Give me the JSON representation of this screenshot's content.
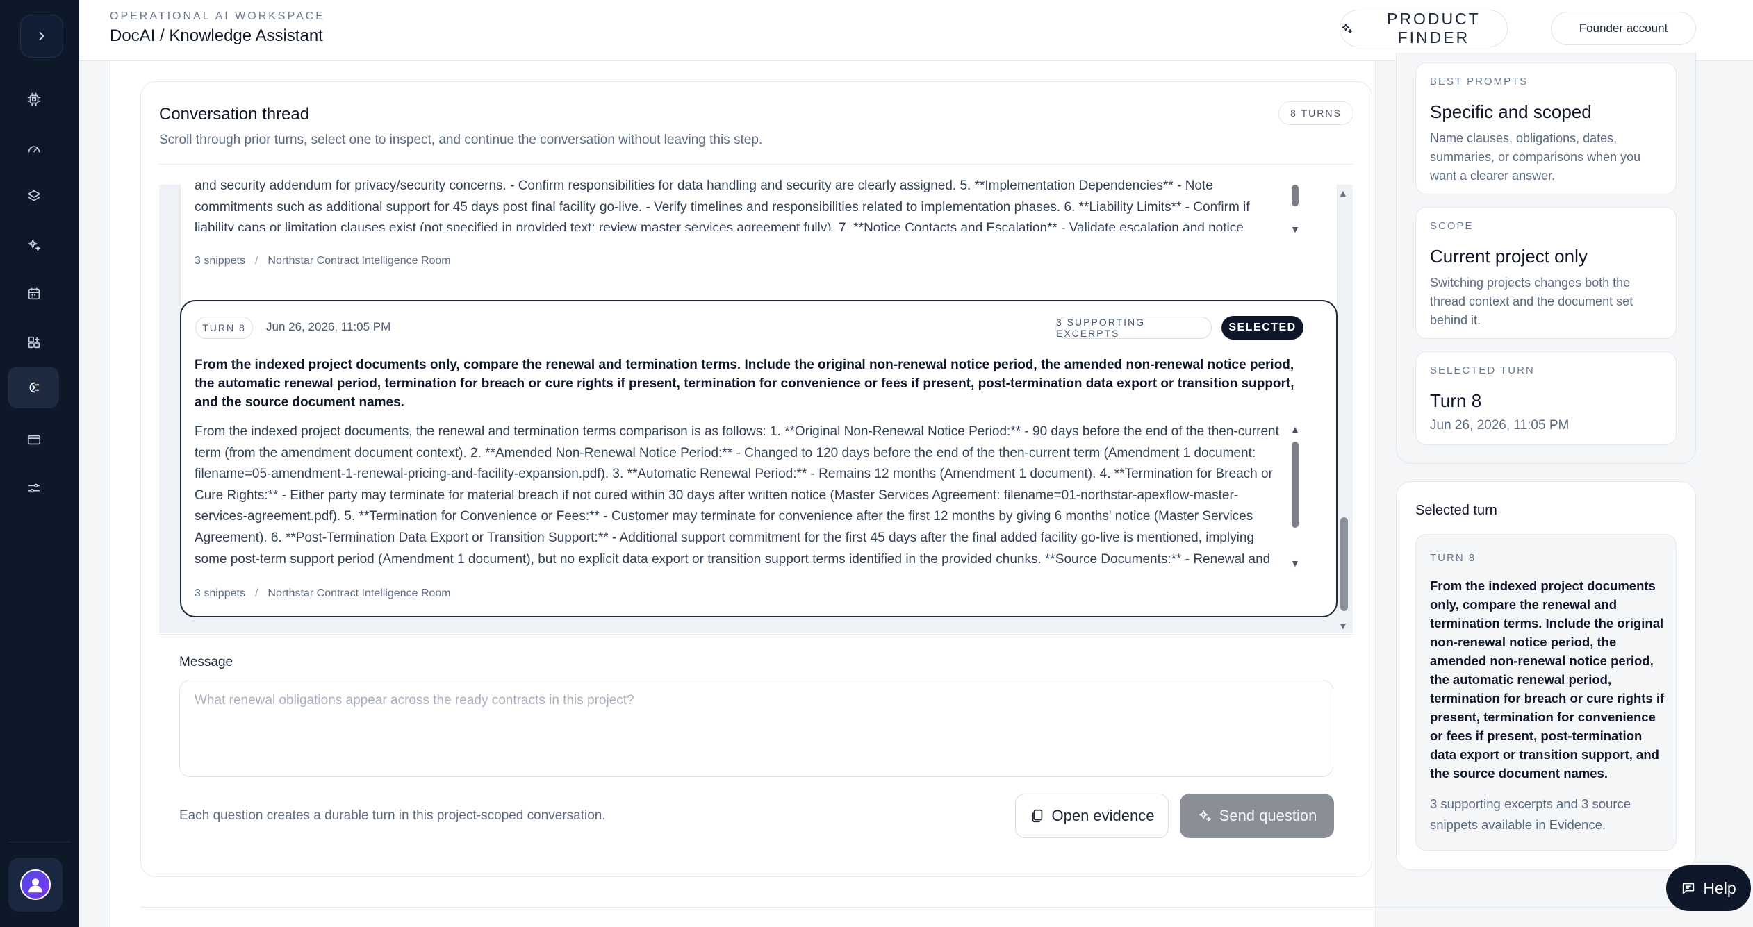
{
  "header": {
    "kicker": "OPERATIONAL AI WORKSPACE",
    "title": "DocAI / Knowledge Assistant",
    "product_finder": "PRODUCT FINDER",
    "account": "Founder account"
  },
  "sidebar": {
    "items": [
      {
        "icon": "cpu-icon"
      },
      {
        "icon": "gauge-icon"
      },
      {
        "icon": "layers-icon"
      },
      {
        "icon": "sparkles-icon"
      },
      {
        "icon": "calendar-icon"
      },
      {
        "icon": "grid-plus-icon"
      },
      {
        "icon": "brain-icon",
        "active": true
      },
      {
        "icon": "credit-card-icon"
      },
      {
        "icon": "sliders-icon"
      }
    ]
  },
  "thread": {
    "title": "Conversation thread",
    "subtitle": "Scroll through prior turns, select one to inspect, and continue the conversation without leaving this step.",
    "turns_badge": "8 TURNS",
    "previous_turn": {
      "answer_visible": "and security addendum for privacy/security concerns. - Confirm responsibilities for data handling and security are clearly assigned. 5. **Implementation Dependencies** - Note commitments such as additional support for 45 days post final facility go-live. - Verify timelines and responsibilities related to implementation phases. 6. **Liability Limits** - Confirm if liability caps or limitation clauses exist (not specified in provided text; review master services agreement fully). 7. **Notice Contacts and Escalation** - Validate escalation and notice contacts",
      "snippets": "3 snippets",
      "separator": "/",
      "room": "Northstar Contract Intelligence Room"
    },
    "selected_turn": {
      "turn_label": "TURN 8",
      "date": "Jun 26, 2026, 11:05 PM",
      "excerpts": "3 SUPPORTING EXCERPTS",
      "selected": "SELECTED",
      "question": "From the indexed project documents only, compare the renewal and termination terms. Include the original non-renewal notice period, the amended non-renewal notice period, the automatic renewal period, termination for breach or cure rights if present, termination for convenience or fees if present, post-termination data export or transition support, and the source document names.",
      "answer": "From the indexed project documents, the renewal and termination terms comparison is as follows: 1. **Original Non-Renewal Notice Period:** - 90 days before the end of the then-current term (from the amendment document context). 2. **Amended Non-Renewal Notice Period:** - Changed to 120 days before the end of the then-current term (Amendment 1 document: filename=05-amendment-1-renewal-pricing-and-facility-expansion.pdf). 3. **Automatic Renewal Period:** - Remains 12 months (Amendment 1 document). 4. **Termination for Breach or Cure Rights:** - Either party may terminate for material breach if not cured within 30 days after written notice (Master Services Agreement: filename=01-northstar-apexflow-master-services-agreement.pdf). 5. **Termination for Convenience or Fees:** - Customer may terminate for convenience after the first 12 months by giving 6 months' notice (Master Services Agreement). 6. **Post-Termination Data Export or Transition Support:** - Additional support commitment for the first 45 days after the final added facility go-live is mentioned, implying some post-term support period (Amendment 1 document), but no explicit data export or transition support terms identified in the provided chunks. **Source Documents:** - Renewal and",
      "snippets": "3 snippets",
      "separator": "/",
      "room": "Northstar Contract Intelligence Room"
    }
  },
  "composer": {
    "label": "Message",
    "placeholder": "What renewal obligations appear across the ready contracts in this project?",
    "value": "",
    "note": "Each question creates a durable turn in this project-scoped conversation.",
    "open_evidence": "Open evidence",
    "send": "Send question"
  },
  "right_panel": {
    "best_prompts": {
      "kicker": "BEST PROMPTS",
      "title": "Specific and scoped",
      "body": "Name clauses, obligations, dates, summaries, or comparisons when you want a clearer answer."
    },
    "scope": {
      "kicker": "SCOPE",
      "title": "Current project only",
      "body": "Switching projects changes both the thread context and the document set behind it."
    },
    "selected_turn_card": {
      "kicker": "SELECTED TURN",
      "title": "Turn 8",
      "date": "Jun 26, 2026, 11:05 PM"
    },
    "selected_turn_panel": {
      "title": "Selected turn",
      "kicker": "TURN 8",
      "question": "From the indexed project documents only, compare the renewal and termination terms. Include the original non-renewal notice period, the amended non-renewal notice period, the automatic renewal period, termination for breach or cure rights if present, termination for convenience or fees if present, post-termination data export or transition support, and the source document names.",
      "note": "3 supporting excerpts and 3 source snippets available in Evidence."
    }
  },
  "help": {
    "label": "Help"
  }
}
